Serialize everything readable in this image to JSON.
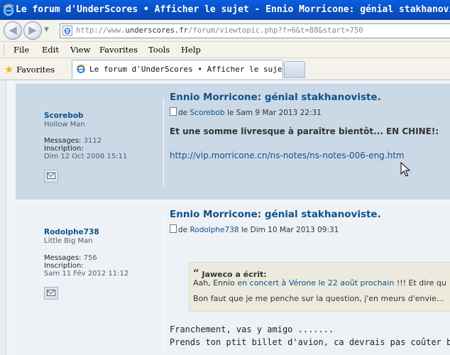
{
  "window": {
    "title": "Le forum d'UnderScores • Afficher le sujet - Ennio Morricone: génial stakhanoviste.",
    "ie_icon": "ie-logo-icon"
  },
  "navigation": {
    "back": "◀",
    "forward": "▶",
    "address_prefix": "http://www.",
    "address_domain": "underscores.fr",
    "address_path": "/forum/viewtopic.php?f=6&t=88&start=750"
  },
  "menu": {
    "items": [
      "File",
      "Edit",
      "View",
      "Favorites",
      "Tools",
      "Help"
    ]
  },
  "tabs": {
    "favorites_label": "Favorites",
    "active_tab": "Le forum d'UnderScores • Afficher le suje..."
  },
  "posts": [
    {
      "author": "Scorebob",
      "rank": "Hollow Man",
      "messages_label": "Messages:",
      "messages": "3112",
      "inscription_label": "Inscription:",
      "inscription_date": "Dim 12 Oct 2008 15:11",
      "title": "Ennio Morricone: génial stakhanoviste.",
      "meta_prefix": "de",
      "meta_author": "Scorebob",
      "meta_date": "le Sam 9 Mar 2013 22:31",
      "body": "Et une somme livresque à paraître bientôt... EN CHINE!:",
      "link": "http://vip.morricone.cn/ns-notes/ns-notes-006-eng.htm"
    },
    {
      "author": "Rodolphe738",
      "rank": "Little Big Man",
      "messages_label": "Messages:",
      "messages": "756",
      "inscription_label": "Inscription:",
      "inscription_date": "Sam 11 Fév 2012 11:12",
      "title": "Ennio Morricone: génial stakhanoviste.",
      "meta_prefix": "de",
      "meta_author": "Rodolphe738",
      "meta_date": "le Dim 10 Mar 2013 09:31",
      "quote_author": "Jaweco a écrit:",
      "quote_line1_a": "Aah, Ennio ",
      "quote_line1_link": "en concert à Vérone le 22 août prochain",
      "quote_line1_b": " !!! Et dire qu",
      "quote_line2": "Bon faut que je me penche sur la question, j'en meurs d'envie...",
      "text_line1": "Franchement, vas y amigo .......",
      "text_line2": "Prends ton ptit billet d'avion, ca devrais pas coûter bien cher en le"
    }
  ]
}
